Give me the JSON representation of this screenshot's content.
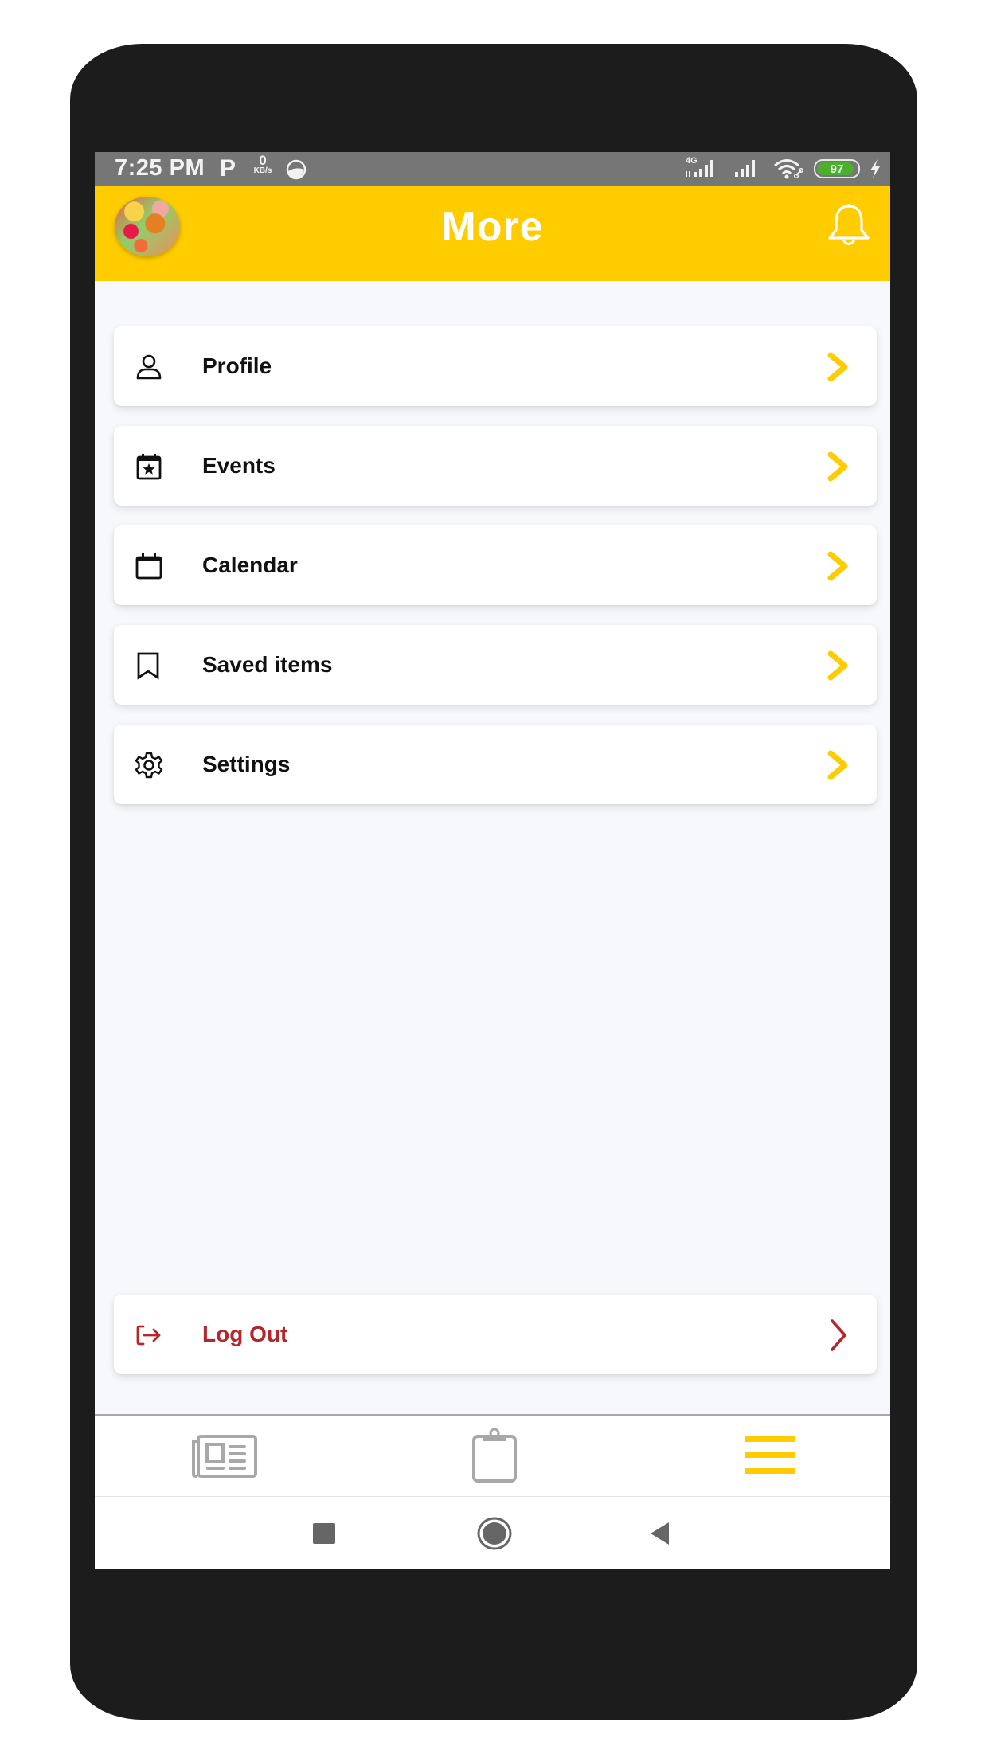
{
  "status_bar": {
    "time": "7:25 PM",
    "p_icon": "P",
    "net_speed_value": "0",
    "net_speed_unit": "KB/s",
    "network_type": "4G",
    "battery_level": "97",
    "icons": [
      "parking-icon",
      "app-notification-icon",
      "signal-4g-icon",
      "signal-icon",
      "wifi-icon",
      "battery-icon",
      "charging-icon"
    ]
  },
  "header": {
    "title": "More",
    "avatar": "profile-avatar",
    "notification_icon": "bell-icon",
    "background_color": "#FFCC00"
  },
  "menu": {
    "items": [
      {
        "label": "Profile",
        "icon": "user-icon"
      },
      {
        "label": "Events",
        "icon": "calendar-star-icon"
      },
      {
        "label": "Calendar",
        "icon": "calendar-icon"
      },
      {
        "label": "Saved items",
        "icon": "bookmark-icon"
      },
      {
        "label": "Settings",
        "icon": "gear-icon"
      }
    ],
    "chevron_color": "#FFCC00"
  },
  "logout": {
    "label": "Log Out",
    "icon": "logout-icon",
    "color": "#B5272D"
  },
  "bottom_nav": {
    "items": [
      {
        "name": "news",
        "icon": "newspaper-icon",
        "active": false
      },
      {
        "name": "clipboard",
        "icon": "clipboard-icon",
        "active": false
      },
      {
        "name": "more",
        "icon": "menu-icon",
        "active": true
      }
    ],
    "active_color": "#FFCC00",
    "inactive_color": "#A8A8A8"
  },
  "system_nav": {
    "buttons": [
      "recents-button",
      "home-button",
      "back-button"
    ]
  }
}
